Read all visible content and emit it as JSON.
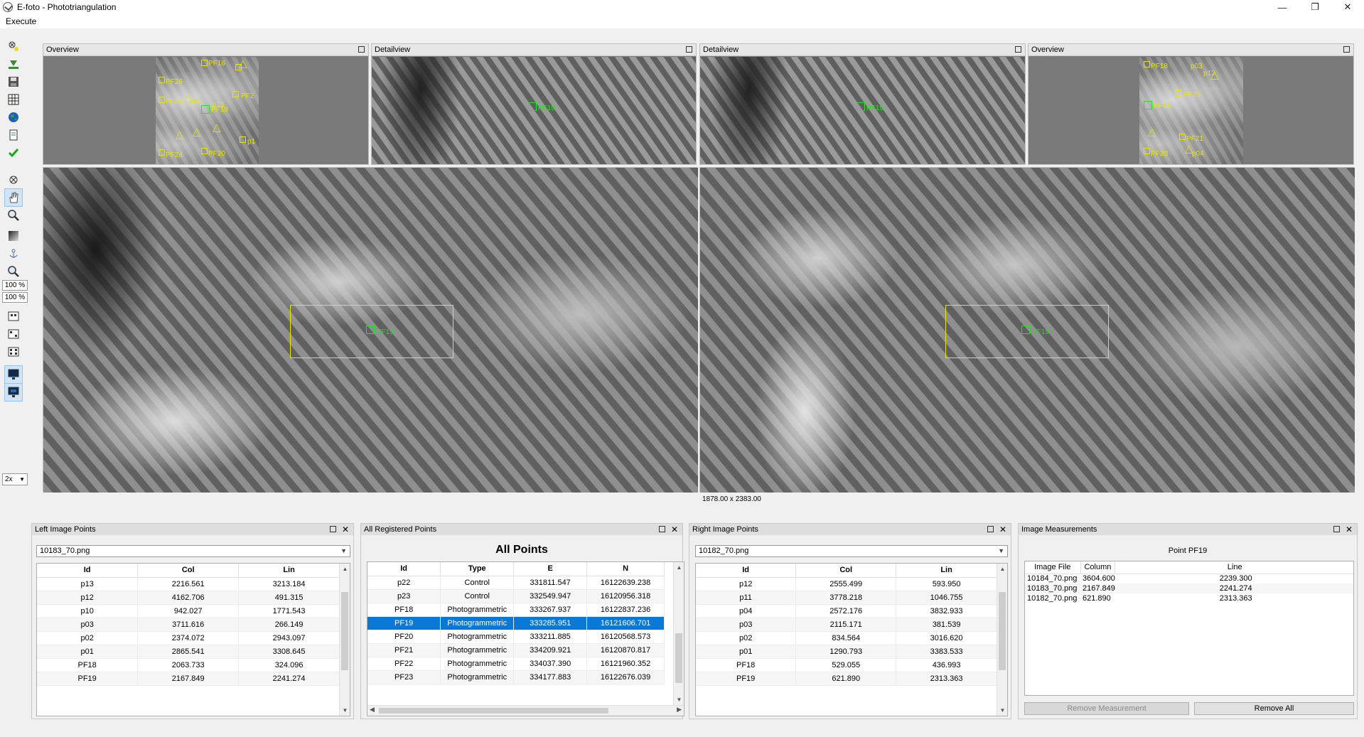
{
  "window": {
    "title": "E-foto - Phototriangulation",
    "minimize": "—",
    "restore": "❐",
    "close": "✕"
  },
  "menu": {
    "execute": "Execute"
  },
  "toolbar": {
    "zoom_left": "100 %",
    "zoom_right": "100 %",
    "scale": "2x"
  },
  "panels": {
    "left_overview": "Overview",
    "left_detail": "Detailview",
    "right_detail": "Detailview",
    "right_overview": "Overview"
  },
  "markers": {
    "pf19": "PF19",
    "left_overview": [
      "PF18",
      "PF26",
      "PF25",
      "PF19",
      "PF24",
      "PF20",
      "PF2",
      "p13",
      "p15",
      "p1"
    ],
    "right_overview": [
      "PF18",
      "PF19",
      "PF22",
      "PF21",
      "PF20",
      "p12",
      "p03",
      "p04"
    ]
  },
  "status": {
    "dimensions": "1878.00 x 2383.00"
  },
  "left_points": {
    "title": "Left Image Points",
    "file": "10183_70.png",
    "columns": [
      "Id",
      "Col",
      "Lin"
    ],
    "rows": [
      [
        "p13",
        "2216.561",
        "3213.184"
      ],
      [
        "p12",
        "4162.706",
        "491.315"
      ],
      [
        "p10",
        "942.027",
        "1771.543"
      ],
      [
        "p03",
        "3711.616",
        "266.149"
      ],
      [
        "p02",
        "2374.072",
        "2943.097"
      ],
      [
        "p01",
        "2865.541",
        "3308.645"
      ],
      [
        "PF18",
        "2063.733",
        "324.096"
      ],
      [
        "PF19",
        "2167.849",
        "2241.274"
      ]
    ]
  },
  "all_points": {
    "title": "All Registered Points",
    "heading": "All Points",
    "columns": [
      "Id",
      "Type",
      "E",
      "N"
    ],
    "rows": [
      [
        "p22",
        "Control",
        "331811.547",
        "16122639.238"
      ],
      [
        "p23",
        "Control",
        "332549.947",
        "16120956.318"
      ],
      [
        "PF18",
        "Photogrammetric",
        "333267.937",
        "16122837.236"
      ],
      [
        "PF19",
        "Photogrammetric",
        "333285.951",
        "16121606.701"
      ],
      [
        "PF20",
        "Photogrammetric",
        "333211.885",
        "16120568.573"
      ],
      [
        "PF21",
        "Photogrammetric",
        "334209.921",
        "16120870.817"
      ],
      [
        "PF22",
        "Photogrammetric",
        "334037.390",
        "16121960.352"
      ],
      [
        "PF23",
        "Photogrammetric",
        "334177.883",
        "16122676.039"
      ]
    ],
    "selected_index": 3
  },
  "right_points": {
    "title": "Right Image Points",
    "file": "10182_70.png",
    "columns": [
      "Id",
      "Col",
      "Lin"
    ],
    "rows": [
      [
        "p12",
        "2555.499",
        "593.950"
      ],
      [
        "p11",
        "3778.218",
        "1046.755"
      ],
      [
        "p04",
        "2572.176",
        "3832.933"
      ],
      [
        "p03",
        "2115.171",
        "381.539"
      ],
      [
        "p02",
        "834.564",
        "3016.620"
      ],
      [
        "p01",
        "1290.793",
        "3383.533"
      ],
      [
        "PF18",
        "529.055",
        "436.993"
      ],
      [
        "PF19",
        "621.890",
        "2313.363"
      ]
    ]
  },
  "measurements": {
    "title": "Image Measurements",
    "point_label": "Point PF19",
    "columns": [
      "Image File",
      "Column",
      "Line"
    ],
    "rows": [
      [
        "10184_70.png",
        "3604.600",
        "2239.300"
      ],
      [
        "10183_70.png",
        "2167.849",
        "2241.274"
      ],
      [
        "10182_70.png",
        "621.890",
        "2313.363"
      ]
    ],
    "remove_measurement": "Remove Measurement",
    "remove_all": "Remove All"
  },
  "colors": {
    "marker_yellow": "#e6e600",
    "marker_green": "#27e027",
    "selection": "#0a78d7"
  }
}
